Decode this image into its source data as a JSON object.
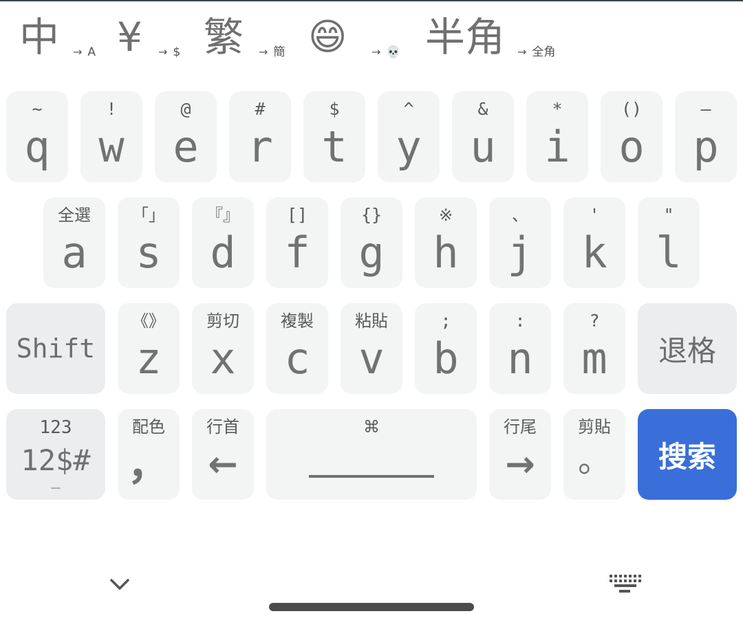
{
  "toolbar": {
    "items": [
      {
        "main": "中",
        "sub": "A"
      },
      {
        "main": "¥",
        "sub": "$"
      },
      {
        "main": "繁",
        "sub": "簡"
      },
      {
        "main": "😄",
        "sub": "💀"
      },
      {
        "main": "半角",
        "sub": "全角"
      }
    ],
    "arrow": "→"
  },
  "row1": [
    {
      "sec": "~",
      "pri": "q"
    },
    {
      "sec": "!",
      "pri": "w"
    },
    {
      "sec": "@",
      "pri": "e"
    },
    {
      "sec": "#",
      "pri": "r"
    },
    {
      "sec": "$",
      "pri": "t"
    },
    {
      "sec": "^",
      "pri": "y"
    },
    {
      "sec": "&",
      "pri": "u"
    },
    {
      "sec": "*",
      "pri": "i"
    },
    {
      "sec": "()",
      "pri": "o"
    },
    {
      "sec": "—",
      "pri": "p"
    }
  ],
  "row2": [
    {
      "sec": "全選",
      "pri": "a"
    },
    {
      "sec": "「」",
      "pri": "s"
    },
    {
      "sec": "『』",
      "pri": "d"
    },
    {
      "sec": "[]",
      "pri": "f"
    },
    {
      "sec": "{}",
      "pri": "g"
    },
    {
      "sec": "※",
      "pri": "h"
    },
    {
      "sec": "、",
      "pri": "j"
    },
    {
      "sec": "'",
      "pri": "k"
    },
    {
      "sec": "\"",
      "pri": "l"
    }
  ],
  "row3": {
    "shift": "Shift",
    "keys": [
      {
        "sec": "《》",
        "pri": "z"
      },
      {
        "sec": "剪切",
        "pri": "x"
      },
      {
        "sec": "複製",
        "pri": "c"
      },
      {
        "sec": "粘貼",
        "pri": "v"
      },
      {
        "sec": ";",
        "pri": "b"
      },
      {
        "sec": ":",
        "pri": "n"
      },
      {
        "sec": "?",
        "pri": "m"
      }
    ],
    "backspace": "退格"
  },
  "row4": {
    "num": {
      "top": "123",
      "mid": "12$#",
      "bot": "_"
    },
    "color": {
      "sec": "配色",
      "pri": "，"
    },
    "line_start": {
      "sec": "行首",
      "pri": "←"
    },
    "space": {
      "sec": "⌘"
    },
    "line_end": {
      "sec": "行尾",
      "pri": "→"
    },
    "paste": {
      "sec": "剪貼",
      "pri": "。"
    },
    "search": "搜索"
  },
  "navbar": {
    "hide_icon": "chevron-down-icon",
    "switch_icon": "keyboard-icon"
  },
  "colors": {
    "key_bg": "#f3f5f5",
    "function_key_bg": "#ebedef",
    "search_key_bg": "#3a6fd9",
    "key_text": "#707070"
  }
}
